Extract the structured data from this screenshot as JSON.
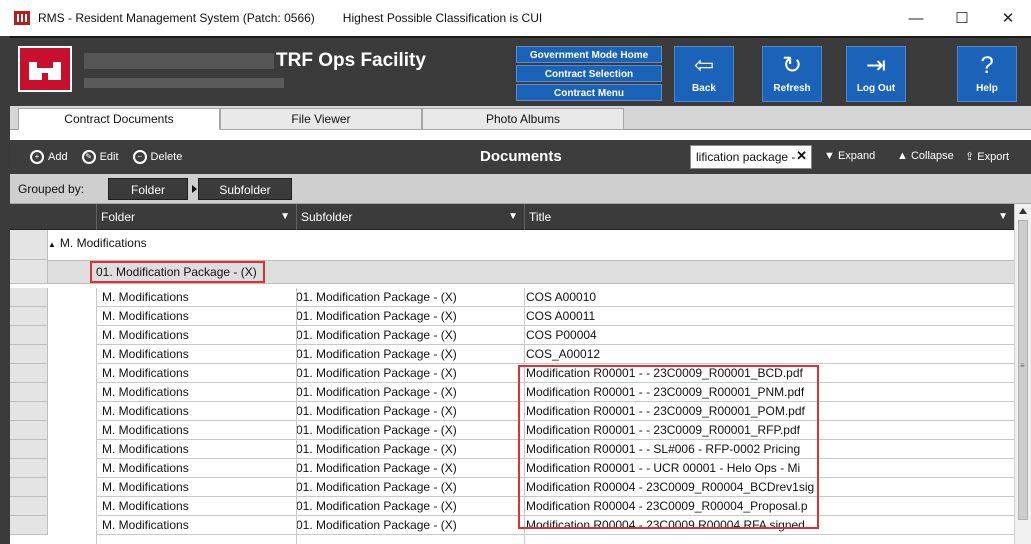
{
  "window": {
    "title": "RMS - Resident Management System (Patch: 0566)",
    "classification": "Highest Possible Classification is CUI",
    "controls": [
      "—",
      "☐",
      "✕"
    ]
  },
  "header": {
    "facility_name": "TRF Ops Facility",
    "gov_menu": [
      "Government Mode Home",
      "Contract Selection",
      "Contract Menu"
    ],
    "nav_buttons": [
      {
        "label": "Back",
        "icon": "back-arrow-icon"
      },
      {
        "label": "Refresh",
        "icon": "refresh-icon"
      },
      {
        "label": "Log Out",
        "icon": "logout-icon"
      },
      {
        "label": "Help",
        "icon": "help-icon"
      }
    ]
  },
  "tabs": [
    "Contract Documents",
    "File Viewer",
    "Photo Albums"
  ],
  "toolbar": {
    "add": "Add",
    "edit": "Edit",
    "delete": "Delete",
    "title": "Documents",
    "search_value": "lification package -",
    "expand": "Expand",
    "collapse": "Collapse",
    "export": "Export"
  },
  "grouping": {
    "label": "Grouped by:",
    "chips": [
      "Folder",
      "Subfolder"
    ]
  },
  "grid": {
    "columns": [
      "Folder",
      "Subfolder",
      "Title"
    ],
    "group1": "M. Modifications",
    "group2": "01. Modification Package - (X)",
    "rows": [
      [
        "M. Modifications",
        "01. Modification Package - (X)",
        "COS A00010"
      ],
      [
        "M. Modifications",
        "01. Modification Package - (X)",
        "COS A00011"
      ],
      [
        "M. Modifications",
        "01. Modification Package - (X)",
        "COS P00004"
      ],
      [
        "M. Modifications",
        "01. Modification Package - (X)",
        "COS_A00012"
      ],
      [
        "M. Modifications",
        "01. Modification Package - (X)",
        "Modification R00001 - - 23C0009_R00001_BCD.pdf"
      ],
      [
        "M. Modifications",
        "01. Modification Package - (X)",
        "Modification R00001 - - 23C0009_R00001_PNM.pdf"
      ],
      [
        "M. Modifications",
        "01. Modification Package - (X)",
        "Modification R00001 - - 23C0009_R00001_POM.pdf"
      ],
      [
        "M. Modifications",
        "01. Modification Package - (X)",
        "Modification R00001 - - 23C0009_R00001_RFP.pdf"
      ],
      [
        "M. Modifications",
        "01. Modification Package - (X)",
        "Modification R00001 - - SL#006 - RFP-0002 Pricing"
      ],
      [
        "M. Modifications",
        "01. Modification Package - (X)",
        "Modification R00001 - - UCR 00001 - Helo Ops - Mi"
      ],
      [
        "M. Modifications",
        "01. Modification Package - (X)",
        "Modification R00004 - 23C0009_R00004_BCDrev1sig"
      ],
      [
        "M. Modifications",
        "01. Modification Package - (X)",
        "Modification R00004 - 23C0009_R00004_Proposal.p"
      ],
      [
        "M. Modifications",
        "01. Modification Package - (X)",
        "Modification R00004 - 23C0009 R00004 RFA signed"
      ]
    ]
  },
  "colors": {
    "accent_blue": "#1b63b8",
    "dark_panel": "#3b3b3b",
    "highlight_red": "#e03131",
    "logo_red": "#c8102e"
  }
}
